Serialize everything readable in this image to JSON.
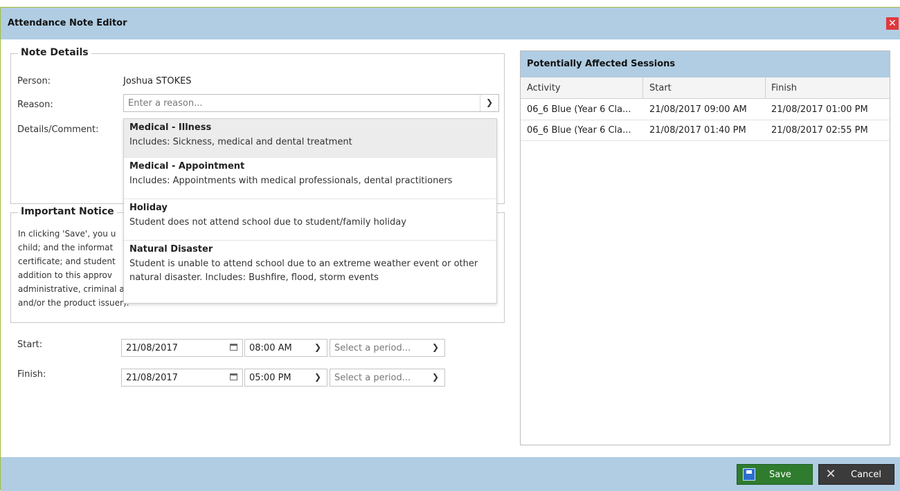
{
  "window": {
    "title": "Attendance Note Editor",
    "close_icon": "close-icon"
  },
  "note_details": {
    "legend": "Note Details",
    "person_label": "Person:",
    "person_value": "Joshua STOKES",
    "reason_label": "Reason:",
    "reason_placeholder": "Enter a reason...",
    "details_label": "Details/Comment:"
  },
  "reason_dropdown": {
    "items": [
      {
        "title": "Medical - Illness",
        "desc": "Includes: Sickness, medical and dental treatment"
      },
      {
        "title": "Medical - Appointment",
        "desc": "Includes: Appointments with medical professionals, dental practitioners"
      },
      {
        "title": "Holiday",
        "desc": "Student does not attend school due to student/family holiday"
      },
      {
        "title": "Natural Disaster",
        "desc": "Student is unable to attend school due to an extreme weather event or other natural disaster. Includes: Bushfire, flood, storm events"
      }
    ]
  },
  "notice": {
    "legend": "Important Notice",
    "lines": [
      "In clicking 'Save', you u",
      "child; and the informat",
      "certificate; and student",
      "addition to this approv",
      "administrative, criminal and/or civil action against you (by your registered school, affiliated entities",
      "and/or the product issuer)."
    ]
  },
  "start": {
    "label": "Start:",
    "date": "21/08/2017",
    "time": "08:00 AM",
    "period_placeholder": "Select a period..."
  },
  "finish": {
    "label": "Finish:",
    "date": "21/08/2017",
    "time": "05:00 PM",
    "period_placeholder": "Select a period..."
  },
  "sessions": {
    "title": "Potentially Affected Sessions",
    "columns": [
      "Activity",
      "Start",
      "Finish"
    ],
    "rows": [
      [
        "06_6 Blue (Year 6 Cla...",
        "21/08/2017 09:00 AM",
        "21/08/2017 01:00 PM"
      ],
      [
        "06_6 Blue (Year 6 Cla...",
        "21/08/2017 01:40 PM",
        "21/08/2017 02:55 PM"
      ]
    ]
  },
  "footer": {
    "save_label": "Save",
    "cancel_label": "Cancel"
  },
  "colors": {
    "titlebar": "#b0cde3",
    "save": "#2f7c2f",
    "cancel": "#3b3b3b",
    "close": "#e0383d"
  }
}
